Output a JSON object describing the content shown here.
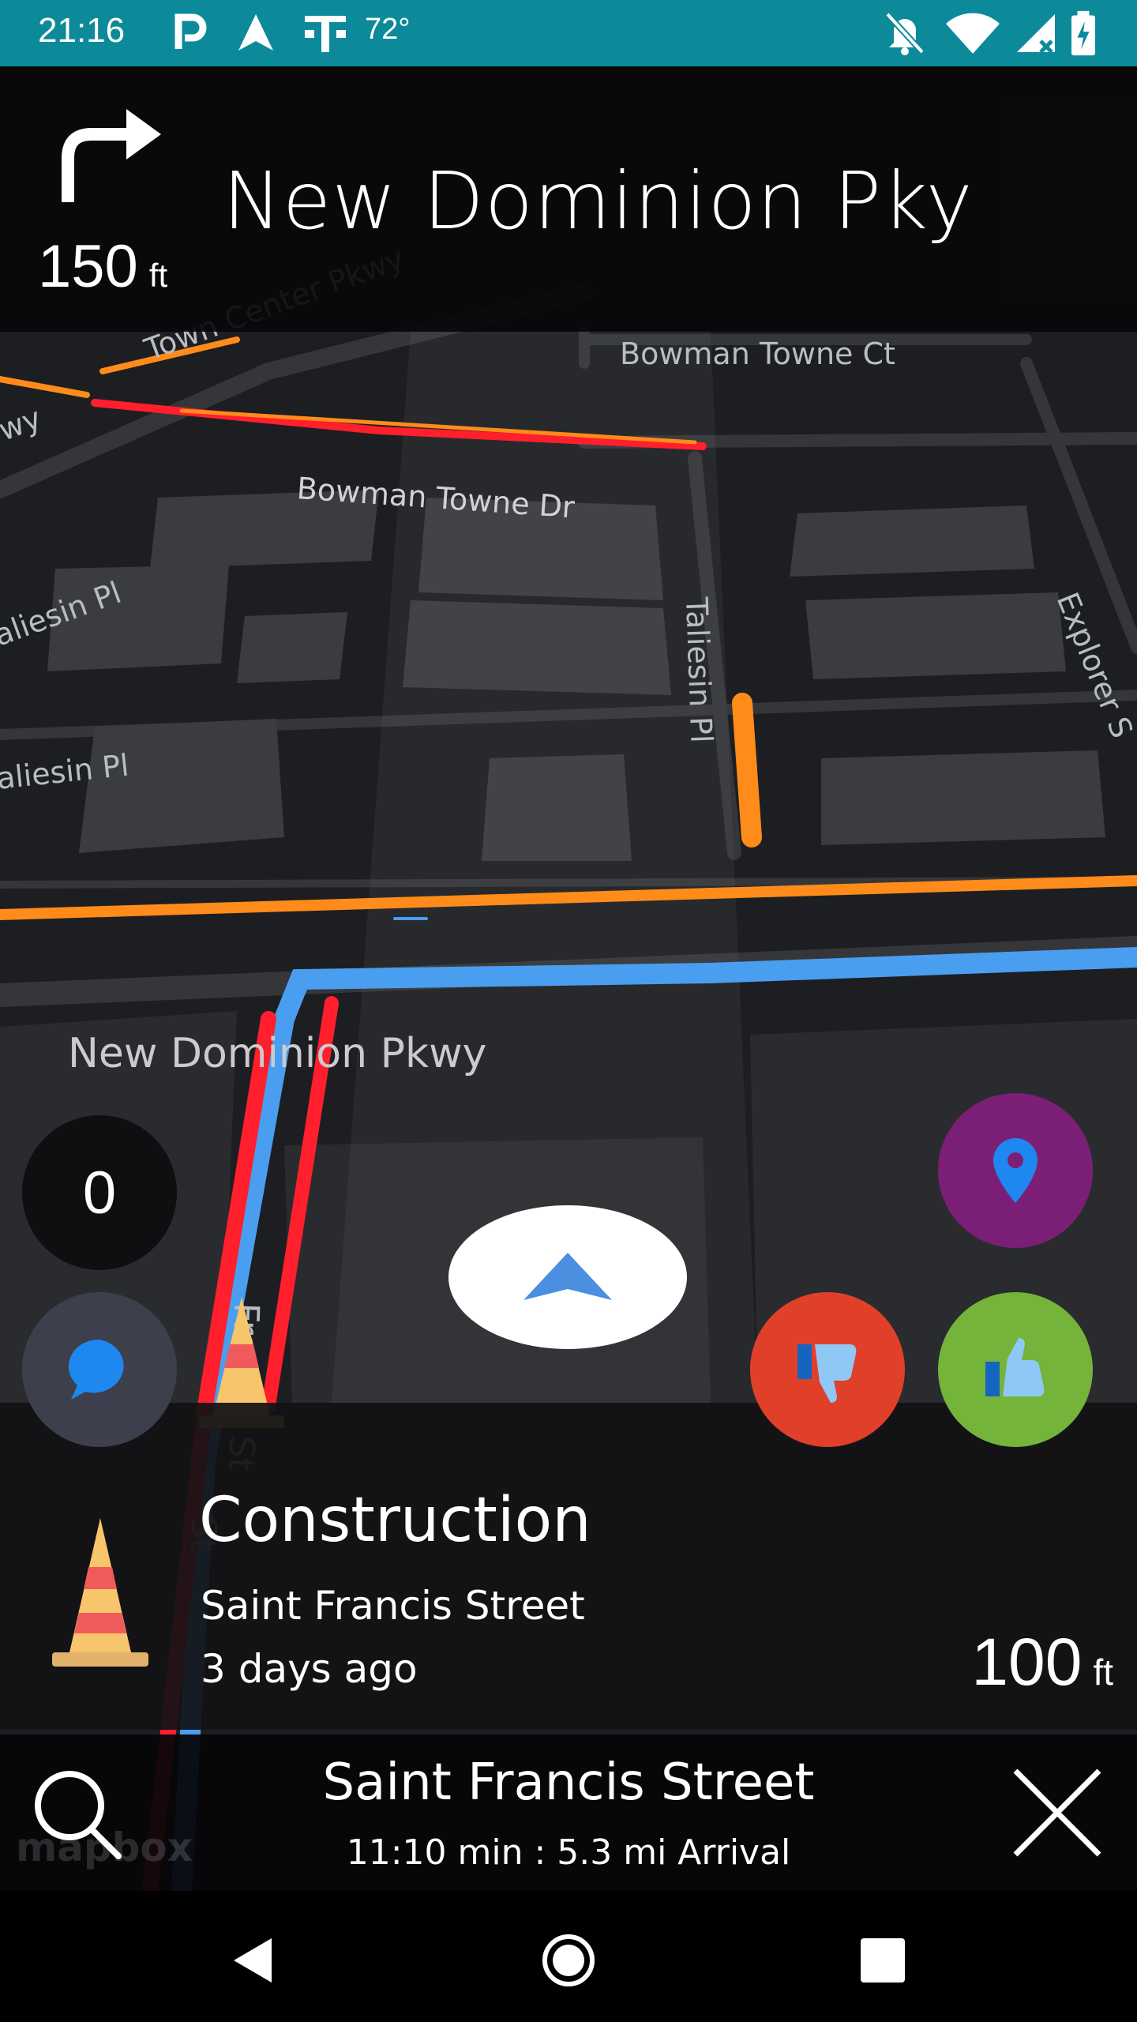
{
  "status_bar": {
    "time": "21:16",
    "temperature": "72°",
    "icons": [
      "parking-icon",
      "navigation-arrow-icon",
      "t-mobile-icon",
      "notifications-off-icon",
      "wifi-icon",
      "signal-icon",
      "battery-charging-icon"
    ],
    "background": "#0d8a9a"
  },
  "maneuver": {
    "icon": "turn-right-icon",
    "distance_value": "150",
    "distance_unit": "ft",
    "street": "New Dominion Pky"
  },
  "map": {
    "labels": {
      "town_center": "Town Center Pkwy",
      "bowman_towne_ct": "Bowman Towne Ct",
      "bowman_towne_dr": "Bowman Towne Dr",
      "taliesin_pl_vertical": "Taliesin Pl",
      "taliesin_pl_1": "aliesin Pl",
      "taliesin_pl_2": "aliesin Pl",
      "explorer": "Explorer S",
      "new_dominion": "New Dominion Pkwy",
      "wy": "wy",
      "st_francis": "Francis St",
      "st_bottom": "St"
    },
    "mapbox": "mapbox"
  },
  "buttons": {
    "speed_value": "0",
    "chat": "chat-icon",
    "location": "location-pin-icon",
    "dislike": "thumbs-down-icon",
    "like": "thumbs-up-icon",
    "recenter": "recenter-arrow-icon"
  },
  "alert": {
    "icon": "traffic-cone-icon",
    "title": "Construction",
    "street": "Saint Francis Street",
    "time_ago": "3 days ago",
    "distance_value": "100",
    "distance_unit": "ft"
  },
  "trip": {
    "destination": "Saint Francis Street",
    "info": "11:10 min : 5.3 mi Arrival",
    "search_icon": "search-icon",
    "close_icon": "close-icon"
  },
  "nav_bar": {
    "back": "back-icon",
    "home": "home-icon",
    "recents": "recents-icon"
  },
  "colors": {
    "route_blue": "#4a9ef0",
    "traffic_red": "#ff1f2d",
    "traffic_orange": "#ff8c1a",
    "like_green": "#74b43a",
    "dislike_red": "#e0402a",
    "location_purple": "#7b1f76"
  }
}
